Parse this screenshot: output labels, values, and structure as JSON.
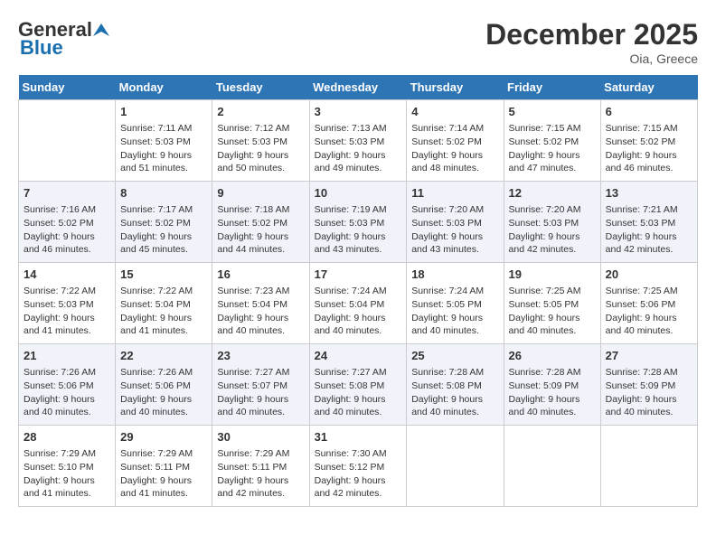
{
  "header": {
    "logo_general": "General",
    "logo_blue": "Blue",
    "month": "December 2025",
    "location": "Oia, Greece"
  },
  "weekdays": [
    "Sunday",
    "Monday",
    "Tuesday",
    "Wednesday",
    "Thursday",
    "Friday",
    "Saturday"
  ],
  "weeks": [
    [
      {
        "day": "",
        "info": ""
      },
      {
        "day": "1",
        "info": "Sunrise: 7:11 AM\nSunset: 5:03 PM\nDaylight: 9 hours\nand 51 minutes."
      },
      {
        "day": "2",
        "info": "Sunrise: 7:12 AM\nSunset: 5:03 PM\nDaylight: 9 hours\nand 50 minutes."
      },
      {
        "day": "3",
        "info": "Sunrise: 7:13 AM\nSunset: 5:03 PM\nDaylight: 9 hours\nand 49 minutes."
      },
      {
        "day": "4",
        "info": "Sunrise: 7:14 AM\nSunset: 5:02 PM\nDaylight: 9 hours\nand 48 minutes."
      },
      {
        "day": "5",
        "info": "Sunrise: 7:15 AM\nSunset: 5:02 PM\nDaylight: 9 hours\nand 47 minutes."
      },
      {
        "day": "6",
        "info": "Sunrise: 7:15 AM\nSunset: 5:02 PM\nDaylight: 9 hours\nand 46 minutes."
      }
    ],
    [
      {
        "day": "7",
        "info": "Sunrise: 7:16 AM\nSunset: 5:02 PM\nDaylight: 9 hours\nand 46 minutes."
      },
      {
        "day": "8",
        "info": "Sunrise: 7:17 AM\nSunset: 5:02 PM\nDaylight: 9 hours\nand 45 minutes."
      },
      {
        "day": "9",
        "info": "Sunrise: 7:18 AM\nSunset: 5:02 PM\nDaylight: 9 hours\nand 44 minutes."
      },
      {
        "day": "10",
        "info": "Sunrise: 7:19 AM\nSunset: 5:03 PM\nDaylight: 9 hours\nand 43 minutes."
      },
      {
        "day": "11",
        "info": "Sunrise: 7:20 AM\nSunset: 5:03 PM\nDaylight: 9 hours\nand 43 minutes."
      },
      {
        "day": "12",
        "info": "Sunrise: 7:20 AM\nSunset: 5:03 PM\nDaylight: 9 hours\nand 42 minutes."
      },
      {
        "day": "13",
        "info": "Sunrise: 7:21 AM\nSunset: 5:03 PM\nDaylight: 9 hours\nand 42 minutes."
      }
    ],
    [
      {
        "day": "14",
        "info": "Sunrise: 7:22 AM\nSunset: 5:03 PM\nDaylight: 9 hours\nand 41 minutes."
      },
      {
        "day": "15",
        "info": "Sunrise: 7:22 AM\nSunset: 5:04 PM\nDaylight: 9 hours\nand 41 minutes."
      },
      {
        "day": "16",
        "info": "Sunrise: 7:23 AM\nSunset: 5:04 PM\nDaylight: 9 hours\nand 40 minutes."
      },
      {
        "day": "17",
        "info": "Sunrise: 7:24 AM\nSunset: 5:04 PM\nDaylight: 9 hours\nand 40 minutes."
      },
      {
        "day": "18",
        "info": "Sunrise: 7:24 AM\nSunset: 5:05 PM\nDaylight: 9 hours\nand 40 minutes."
      },
      {
        "day": "19",
        "info": "Sunrise: 7:25 AM\nSunset: 5:05 PM\nDaylight: 9 hours\nand 40 minutes."
      },
      {
        "day": "20",
        "info": "Sunrise: 7:25 AM\nSunset: 5:06 PM\nDaylight: 9 hours\nand 40 minutes."
      }
    ],
    [
      {
        "day": "21",
        "info": "Sunrise: 7:26 AM\nSunset: 5:06 PM\nDaylight: 9 hours\nand 40 minutes."
      },
      {
        "day": "22",
        "info": "Sunrise: 7:26 AM\nSunset: 5:06 PM\nDaylight: 9 hours\nand 40 minutes."
      },
      {
        "day": "23",
        "info": "Sunrise: 7:27 AM\nSunset: 5:07 PM\nDaylight: 9 hours\nand 40 minutes."
      },
      {
        "day": "24",
        "info": "Sunrise: 7:27 AM\nSunset: 5:08 PM\nDaylight: 9 hours\nand 40 minutes."
      },
      {
        "day": "25",
        "info": "Sunrise: 7:28 AM\nSunset: 5:08 PM\nDaylight: 9 hours\nand 40 minutes."
      },
      {
        "day": "26",
        "info": "Sunrise: 7:28 AM\nSunset: 5:09 PM\nDaylight: 9 hours\nand 40 minutes."
      },
      {
        "day": "27",
        "info": "Sunrise: 7:28 AM\nSunset: 5:09 PM\nDaylight: 9 hours\nand 40 minutes."
      }
    ],
    [
      {
        "day": "28",
        "info": "Sunrise: 7:29 AM\nSunset: 5:10 PM\nDaylight: 9 hours\nand 41 minutes."
      },
      {
        "day": "29",
        "info": "Sunrise: 7:29 AM\nSunset: 5:11 PM\nDaylight: 9 hours\nand 41 minutes."
      },
      {
        "day": "30",
        "info": "Sunrise: 7:29 AM\nSunset: 5:11 PM\nDaylight: 9 hours\nand 42 minutes."
      },
      {
        "day": "31",
        "info": "Sunrise: 7:30 AM\nSunset: 5:12 PM\nDaylight: 9 hours\nand 42 minutes."
      },
      {
        "day": "",
        "info": ""
      },
      {
        "day": "",
        "info": ""
      },
      {
        "day": "",
        "info": ""
      }
    ]
  ]
}
